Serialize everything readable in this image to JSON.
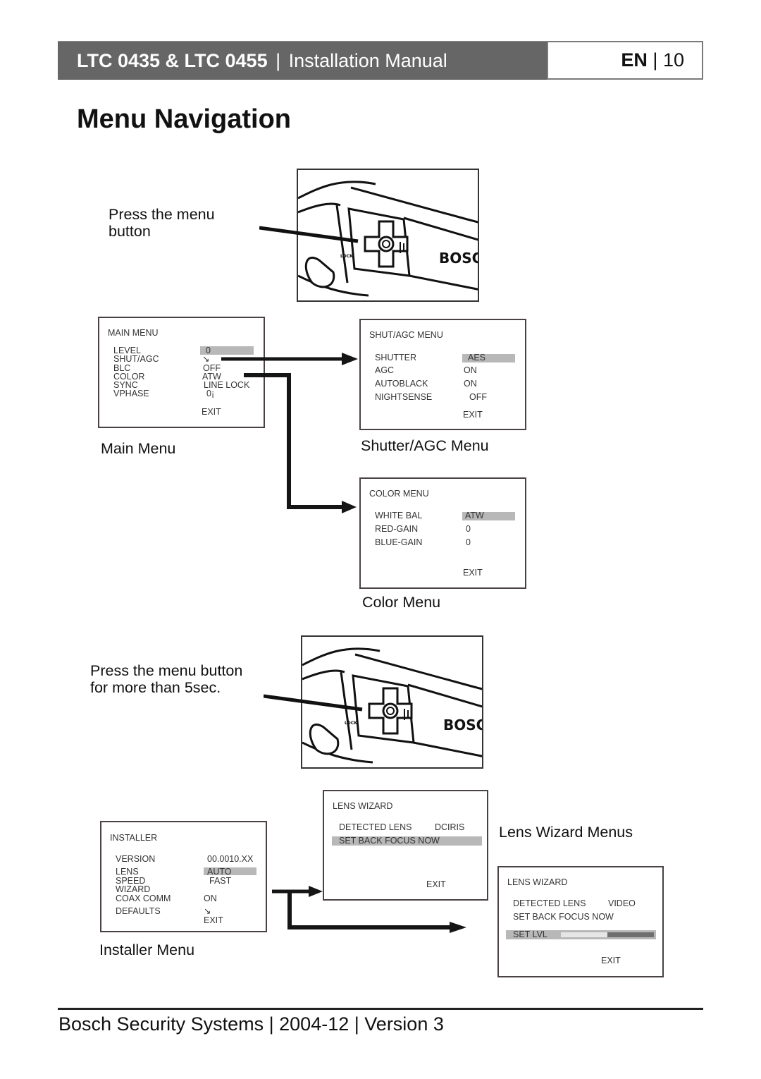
{
  "header": {
    "product": "LTC 0435 & LTC 0455",
    "separator": "|",
    "doc_type": "Installation Manual",
    "language": "EN",
    "page_number": "10"
  },
  "page_title": "Menu Navigation",
  "captions": {
    "press_menu": [
      "Press the menu",
      "button"
    ],
    "press_menu_long": [
      "Press the menu button",
      "for more than 5sec."
    ],
    "main_menu": "Main Menu",
    "shutter_agc_menu": "Shutter/AGC Menu",
    "color_menu": "Color Menu",
    "installer_menu": "Installer Menu",
    "lens_wizard_menus": "Lens Wizard Menus"
  },
  "camera": {
    "brand_text": "BOSC",
    "lock_label": "LOCK"
  },
  "menus": {
    "main": {
      "title": "MAIN MENU",
      "items": [
        {
          "label": "LEVEL",
          "value": "0",
          "highlighted": true
        },
        {
          "label": "SHUT/AGC",
          "value": "↘"
        },
        {
          "label": "BLC",
          "value": "OFF"
        },
        {
          "label": "COLOR",
          "value": "ATW"
        },
        {
          "label": "SYNC",
          "value": "LINE LOCK"
        },
        {
          "label": "VPHASE",
          "value": "0¡"
        }
      ],
      "exit": "EXIT"
    },
    "shut_agc": {
      "title": "SHUT/AGC MENU",
      "items": [
        {
          "label": "SHUTTER",
          "value": "AES",
          "highlighted": true
        },
        {
          "label": "AGC",
          "value": "ON"
        },
        {
          "label": "AUTOBLACK",
          "value": "ON"
        },
        {
          "label": "NIGHTSENSE",
          "value": "OFF"
        }
      ],
      "exit": "EXIT"
    },
    "color": {
      "title": "COLOR MENU",
      "items": [
        {
          "label": "WHITE BAL",
          "value": "ATW",
          "highlighted": true
        },
        {
          "label": "RED-GAIN",
          "value": "0"
        },
        {
          "label": "BLUE-GAIN",
          "value": "0"
        }
      ],
      "exit": "EXIT"
    },
    "installer": {
      "title": "INSTALLER",
      "items": [
        {
          "label": "VERSION",
          "value": "00.0010.XX"
        },
        {
          "label": "LENS",
          "value": "AUTO",
          "highlighted": true
        },
        {
          "label": "SPEED",
          "value": "FAST"
        },
        {
          "label": "WIZARD",
          "value": ""
        },
        {
          "label": "COAX COMM",
          "value": "ON"
        },
        {
          "label": "DEFAULTS",
          "value": "↘"
        }
      ],
      "exit": "EXIT"
    },
    "lens_wizard_dciris": {
      "title": "LENS WIZARD",
      "detected_label": "DETECTED LENS",
      "detected_value": "DCIRIS",
      "set_back_focus": "SET BACK FOCUS NOW",
      "set_back_focus_highlighted": true,
      "exit": "EXIT"
    },
    "lens_wizard_video": {
      "title": "LENS WIZARD",
      "detected_label": "DETECTED LENS",
      "detected_value": "VIDEO",
      "set_back_focus": "SET BACK FOCUS NOW",
      "set_level_label": "SET LVL",
      "set_level_fraction": 0.5,
      "exit": "EXIT"
    }
  },
  "footer": {
    "company": "Bosch Security Systems",
    "date": "2004-12",
    "version": "Version 3",
    "separator": "|"
  }
}
